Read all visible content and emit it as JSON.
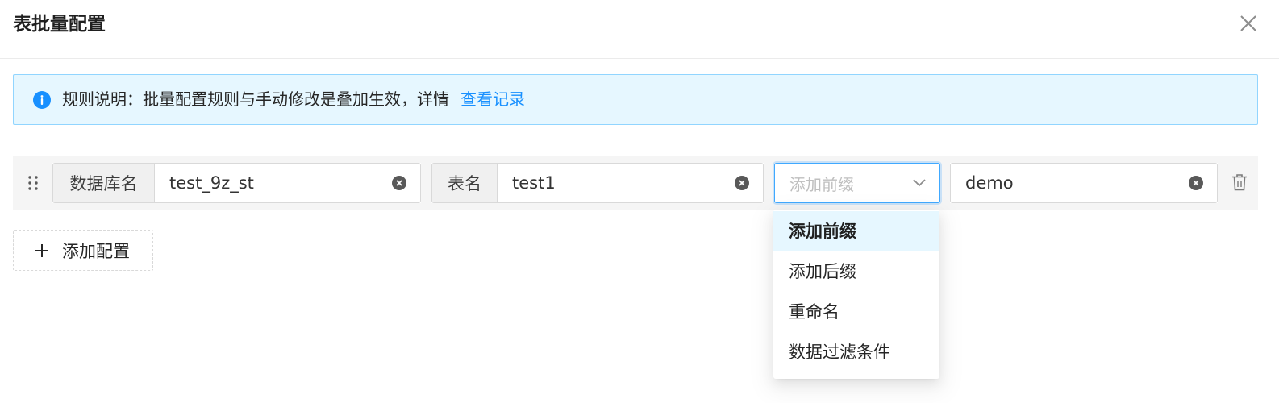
{
  "dialog": {
    "title": "表批量配置"
  },
  "alert": {
    "text": "规则说明：批量配置规则与手动修改是叠加生效，详情",
    "link": "查看记录",
    "icon": "info-icon",
    "color": "#1890ff"
  },
  "config_row": {
    "database": {
      "label": "数据库名",
      "value": "test_9z_st"
    },
    "table": {
      "label": "表名",
      "value": "test1"
    },
    "operation": {
      "placeholder": "添加前缀"
    },
    "operation_value": "demo"
  },
  "add_button": {
    "label": "添加配置"
  },
  "dropdown": {
    "options": [
      "添加前缀",
      "添加后缀",
      "重命名",
      "数据过滤条件"
    ],
    "active_index": 0
  },
  "colors": {
    "primary": "#1890ff",
    "alert_bg": "#e6f7ff",
    "row_bg": "#f5f5f5"
  }
}
